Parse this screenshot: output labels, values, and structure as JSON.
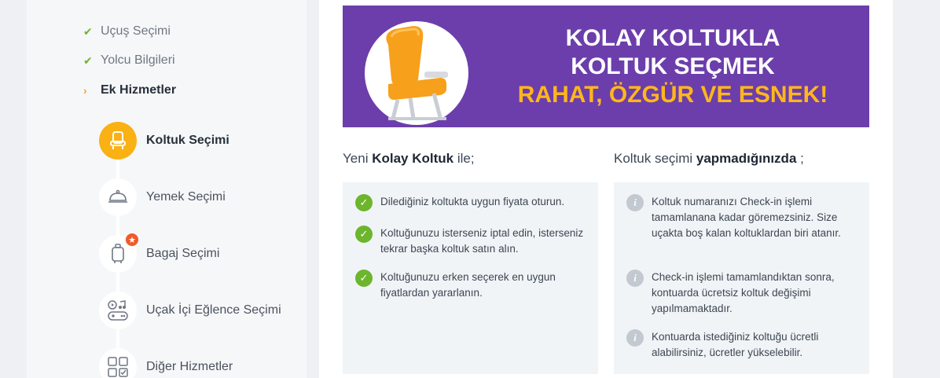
{
  "steps": [
    {
      "label": "Uçuş Seçimi",
      "state": "done",
      "mark": "✔"
    },
    {
      "label": "Yolcu Bilgileri",
      "state": "done",
      "mark": "✔"
    },
    {
      "label": "Ek Hizmetler",
      "state": "active",
      "mark": "›"
    }
  ],
  "services": [
    {
      "label": "Koltuk Seçimi",
      "icon": "seat-icon",
      "active": true
    },
    {
      "label": "Yemek Seçimi",
      "icon": "cloche-icon",
      "active": false
    },
    {
      "label": "Bagaj Seçimi",
      "icon": "luggage-icon",
      "active": false,
      "badge": "★"
    },
    {
      "label": "Uçak İçi Eğlence Seçimi",
      "icon": "entertainment-icon",
      "active": false
    },
    {
      "label": "Diğer Hizmetler",
      "icon": "grid-icon",
      "active": false
    }
  ],
  "banner": {
    "line1": "KOLAY KOLTUKLA",
    "line2": "KOLTUK SEÇMEK",
    "line3": "RAHAT, ÖZGÜR VE ESNEK!"
  },
  "left_column": {
    "title_pre": "Yeni ",
    "title_bold": "Kolay Koltuk",
    "title_post": " ile;",
    "items": [
      "Dilediğiniz koltukta uygun fiyata oturun.",
      "Koltuğunuzu isterseniz iptal edin, isterseniz tekrar başka koltuk satın alın.",
      "Koltuğunuzu erken seçerek en uygun fiyatlardan yararlanın."
    ]
  },
  "right_column": {
    "title_pre": "Koltuk seçimi ",
    "title_bold": "yapmadığınızda",
    "title_post": " ;",
    "items": [
      "Koltuk numaranızı Check-in işlemi tamamlanana kadar göremezsiniz. Size uçakta boş kalan koltuklardan biri atanır.",
      "Check-in işlemi tamamlandıktan sonra, kontuarda ücretsiz koltuk değişimi yapılmamaktadır.",
      "Kontuarda istediğiniz koltuğu ücretli alabilirsiniz, ücretler yükselebilir."
    ]
  },
  "colors": {
    "accent": "#f9b114",
    "banner_bg": "#6c3eab",
    "banner_highlight": "#ffb71b",
    "check": "#6cb52d",
    "badge": "#f05a28"
  }
}
